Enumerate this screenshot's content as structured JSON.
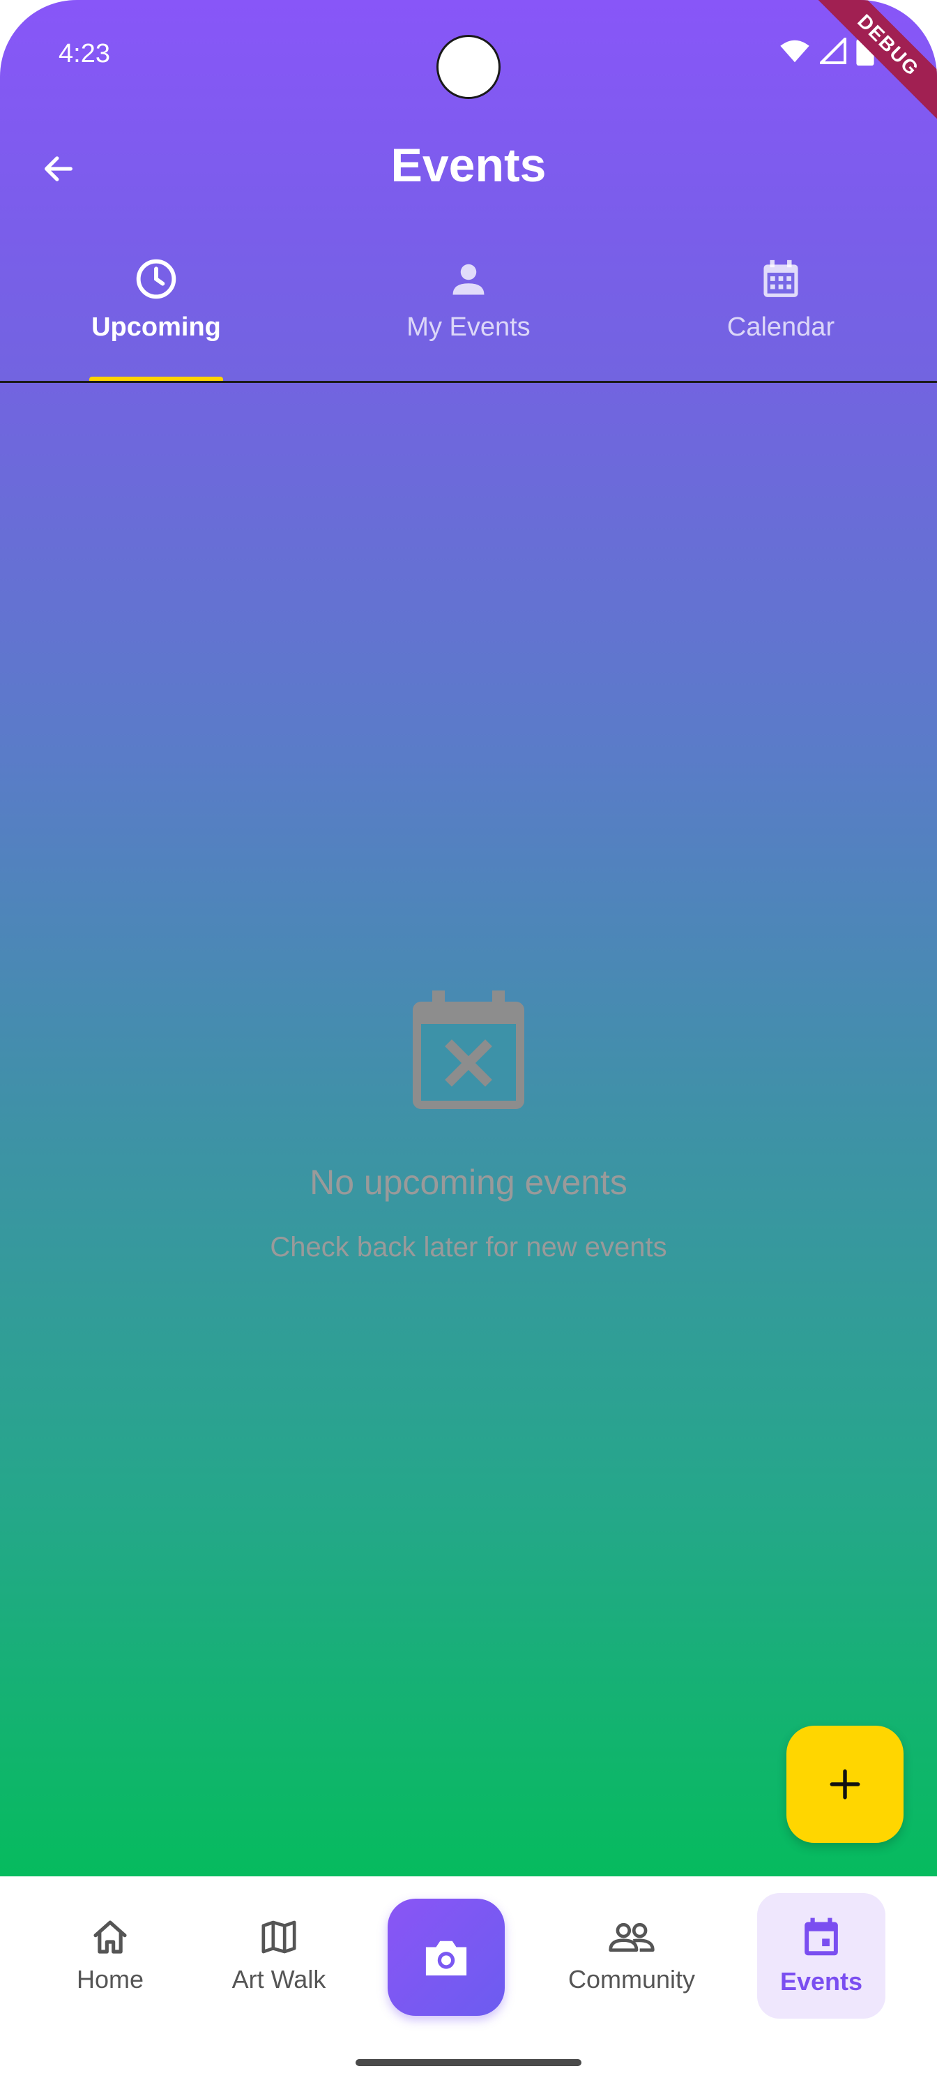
{
  "status_bar": {
    "time": "4:23",
    "debug_label": "DEBUG"
  },
  "header": {
    "title": "Events"
  },
  "tabs": [
    {
      "label": "Upcoming",
      "icon": "clock-icon",
      "active": true
    },
    {
      "label": "My Events",
      "icon": "person-icon",
      "active": false
    },
    {
      "label": "Calendar",
      "icon": "calendar-grid-icon",
      "active": false
    }
  ],
  "empty_state": {
    "icon": "calendar-x-icon",
    "title": "No upcoming events",
    "subtitle": "Check back later for new events"
  },
  "fab": {
    "icon": "plus-icon"
  },
  "bottom_nav": [
    {
      "label": "Home",
      "icon": "home-icon",
      "active": false
    },
    {
      "label": "Art Walk",
      "icon": "map-icon",
      "active": false
    },
    {
      "label": "",
      "icon": "camera-icon",
      "active": false
    },
    {
      "label": "Community",
      "icon": "people-icon",
      "active": false
    },
    {
      "label": "Events",
      "icon": "calendar-icon",
      "active": true
    }
  ],
  "colors": {
    "header_top": "#8856f8",
    "gradient_bottom": "#06bb5e",
    "tab_indicator": "#ffd400",
    "fab": "#ffd600",
    "nav_active": "#7a4ef0",
    "nav_active_bg": "#efe7fd"
  }
}
